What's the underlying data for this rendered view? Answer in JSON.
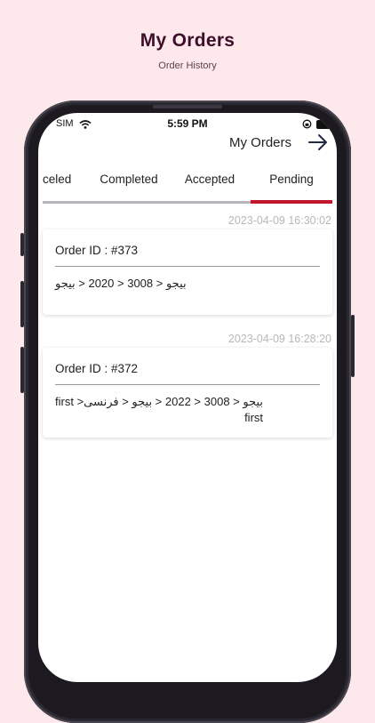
{
  "promo": {
    "title": "My Orders",
    "subtitle": "Order History"
  },
  "status_bar": {
    "carrier": "SIM",
    "time": "5:59 PM"
  },
  "app_bar": {
    "title": "My Orders",
    "back_icon": "arrow-right-icon"
  },
  "tabs": [
    {
      "label": "celed"
    },
    {
      "label": "Completed"
    },
    {
      "label": "Accepted"
    },
    {
      "label": "Pending"
    }
  ],
  "orders": [
    {
      "timestamp": "2023-04-09 16:30:02",
      "order_id": "Order ID : #373",
      "path": "بیجو < 3008 < 2020 < بیجو"
    },
    {
      "timestamp": "2023-04-09 16:28:20",
      "order_id": "Order ID : #372",
      "path": "بیجو < 3008 < 2022 < بیجو < فرنسی< first\nfirst"
    }
  ],
  "colors": {
    "background": "#fde8ec",
    "title": "#3d0f2a",
    "tab_indicator": "#c2162a",
    "tab_track": "#b9b6bb"
  }
}
